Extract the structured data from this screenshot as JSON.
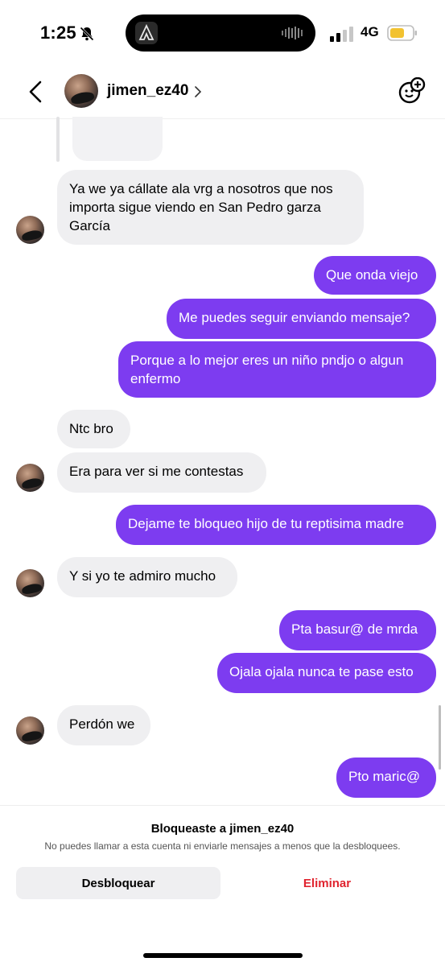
{
  "status_bar": {
    "time": "1:25",
    "network": "4G",
    "battery_color": "#f2c230"
  },
  "header": {
    "username": "jimen_ez40"
  },
  "messages": [
    {
      "from": "them",
      "text": "Ya we ya cállate ala vrg a nosotros que nos importa sigue viendo en San Pedro garza García"
    },
    {
      "from": "me",
      "text": "Que onda viejo"
    },
    {
      "from": "me",
      "text": "Me puedes seguir enviando mensaje?"
    },
    {
      "from": "me",
      "text": "Porque a lo mejor eres un niño pndjo o algun enfermo"
    },
    {
      "from": "them",
      "text": "Ntc bro"
    },
    {
      "from": "them",
      "text": "Era para ver si me contestas"
    },
    {
      "from": "me",
      "text": "Dejame te bloqueo hijo de tu reptisima madre"
    },
    {
      "from": "them",
      "text": "Y si yo te admiro mucho"
    },
    {
      "from": "me",
      "text": "Pta basur@ de mrda"
    },
    {
      "from": "me",
      "text": "Ojala ojala nunca te pase esto"
    },
    {
      "from": "them",
      "text": "Perdón we"
    },
    {
      "from": "me",
      "text": "Pto maric@"
    }
  ],
  "blocked_panel": {
    "title": "Bloqueaste a jimen_ez40",
    "subtitle": "No puedes llamar a esta cuenta ni enviarle mensajes a menos que la desbloquees.",
    "unblock_label": "Desbloquear",
    "delete_label": "Eliminar"
  },
  "colors": {
    "outgoing_bubble": "#7d3cf0",
    "incoming_bubble": "#efeff1",
    "delete_text": "#e0242f"
  },
  "icons": [
    "bell-slash-icon",
    "signal-icon",
    "battery-icon",
    "back-chevron-icon",
    "add-effect-icon"
  ]
}
